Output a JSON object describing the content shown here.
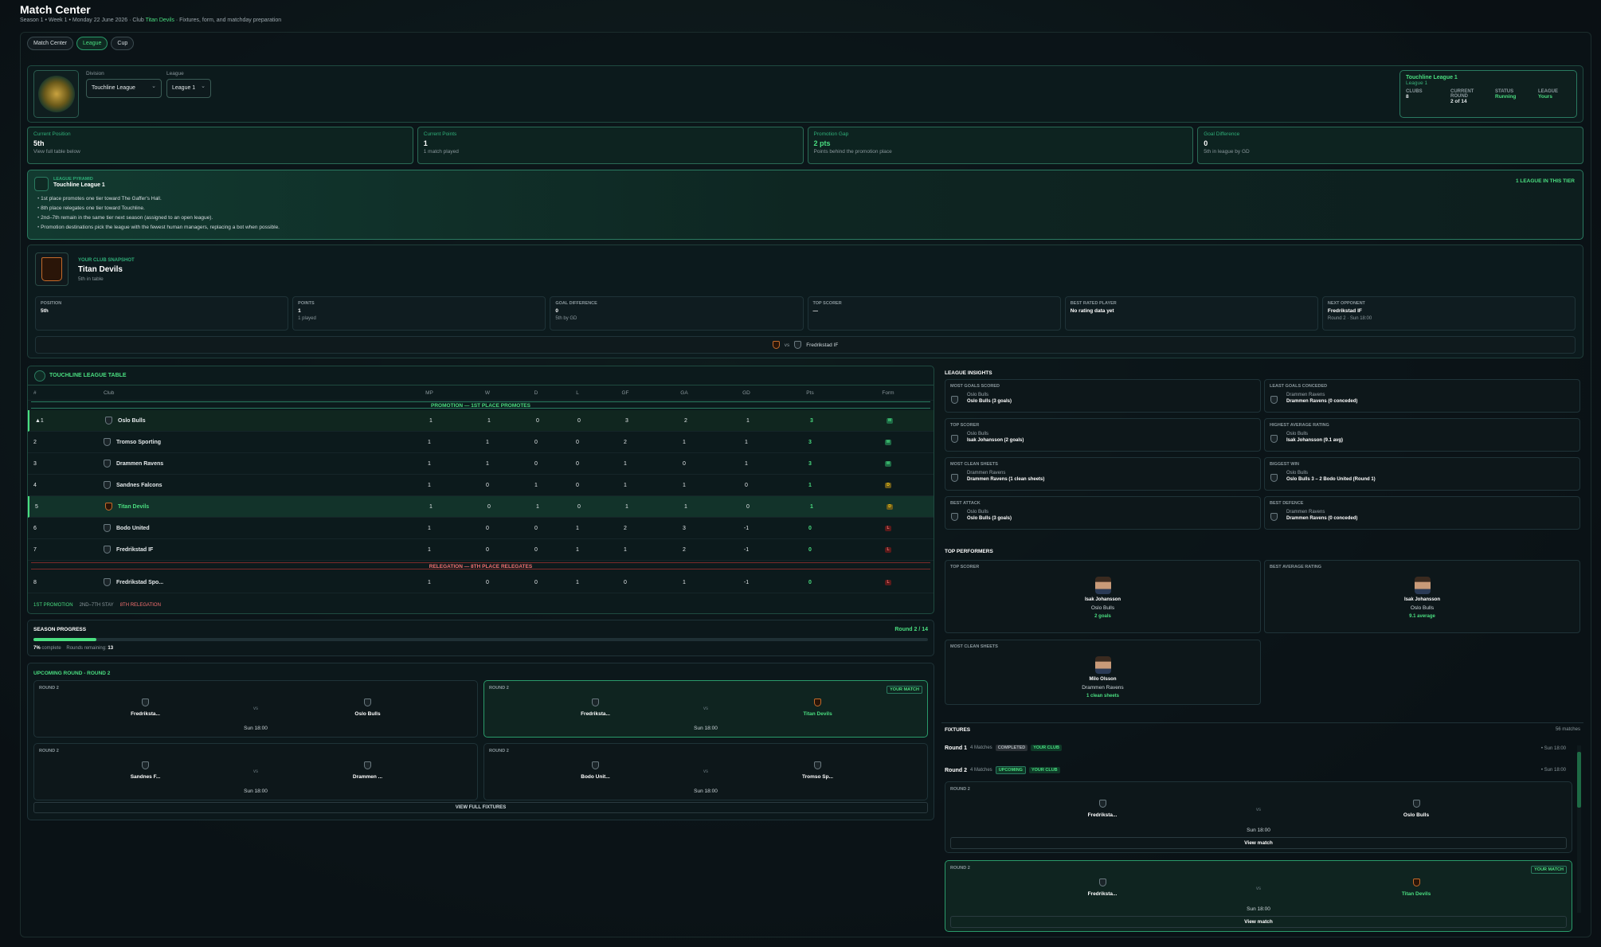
{
  "header": {
    "title": "Match Center",
    "subtitle": "Season 1 • Week 1 • Monday 22 June 2026 · Club",
    "club": "Titan Devils",
    "subtitle_rest": "· Fixtures, form, and matchday preparation"
  },
  "tabs": [
    {
      "label": "Match Center",
      "active": false
    },
    {
      "label": "League",
      "active": true
    },
    {
      "label": "Cup",
      "active": false
    }
  ],
  "selector": {
    "logo_text": "TOUCHLINE FC",
    "division_label": "Division",
    "division_value": "Touchline League",
    "league_label": "League",
    "league_value": "League 1"
  },
  "league_info": {
    "title": "Touchline League 1",
    "subtitle": "League 1",
    "clubs_label": "CLUBS",
    "clubs": "8",
    "round_label": "CURRENT ROUND",
    "round": "2 of 14",
    "status_label": "STATUS",
    "status": "Running",
    "league_label": "LEAGUE",
    "league": "Yours"
  },
  "stats": [
    {
      "label": "Current Position",
      "value": "5th",
      "hint": "View full table below"
    },
    {
      "label": "Current Points",
      "value": "1",
      "hint": "1 match played"
    },
    {
      "label": "Promotion Gap",
      "value": "2 pts",
      "hint": "Points behind the promotion place"
    },
    {
      "label": "Goal Difference",
      "value": "0",
      "hint": "5th in league by GD"
    }
  ],
  "pyramid": {
    "tag": "LEAGUE PYRAMID",
    "name": "Touchline League 1",
    "badge": "1 LEAGUE IN THIS TIER",
    "rules": [
      "1st place promotes one tier toward The Gaffer's Hall.",
      "8th place relegates one tier toward Touchline.",
      "2nd–7th remain in the same tier next season (assigned to an open league).",
      "Promotion destinations pick the league with the fewest human managers, replacing a bot when possible."
    ]
  },
  "snapshot": {
    "tag": "YOUR CLUB SNAPSHOT",
    "name": "Titan Devils",
    "sub": "5th in table",
    "cards": [
      {
        "label": "POSITION",
        "value": "5th",
        "hint": ""
      },
      {
        "label": "POINTS",
        "value": "1",
        "hint": "1 played"
      },
      {
        "label": "GOAL DIFFERENCE",
        "value": "0",
        "hint": "5th by GD"
      },
      {
        "label": "TOP SCORER",
        "value": "—",
        "hint": ""
      },
      {
        "label": "BEST RATED PLAYER",
        "value": "No rating data yet",
        "hint": ""
      },
      {
        "label": "NEXT OPPONENT",
        "value": "Fredrikstad IF",
        "hint": "Round 2 · Sun 18:00"
      }
    ],
    "vs": "vs",
    "next": "Fredrikstad IF"
  },
  "table": {
    "title": "TOUCHLINE LEAGUE TABLE",
    "headers": [
      "#",
      "Club",
      "MP",
      "W",
      "D",
      "L",
      "GF",
      "GA",
      "GD",
      "Pts",
      "Form"
    ],
    "promotion_band": "PROMOTION — 1ST PLACE PROMOTES",
    "relegation_band": "RELEGATION — 8TH PLACE RELEGATES",
    "rows": [
      {
        "pos": "▲1",
        "club": "Oslo Bulls",
        "mp": "1",
        "w": "1",
        "d": "0",
        "l": "0",
        "gf": "3",
        "ga": "2",
        "gd": "1",
        "pts": "3",
        "form": "W"
      },
      {
        "pos": "2",
        "club": "Tromso Sporting",
        "mp": "1",
        "w": "1",
        "d": "0",
        "l": "0",
        "gf": "2",
        "ga": "1",
        "gd": "1",
        "pts": "3",
        "form": "W"
      },
      {
        "pos": "3",
        "club": "Drammen Ravens",
        "mp": "1",
        "w": "1",
        "d": "0",
        "l": "0",
        "gf": "1",
        "ga": "0",
        "gd": "1",
        "pts": "3",
        "form": "W"
      },
      {
        "pos": "4",
        "club": "Sandnes Falcons",
        "mp": "1",
        "w": "0",
        "d": "1",
        "l": "0",
        "gf": "1",
        "ga": "1",
        "gd": "0",
        "pts": "1",
        "form": "D"
      },
      {
        "pos": "5",
        "club": "Titan Devils",
        "mp": "1",
        "w": "0",
        "d": "1",
        "l": "0",
        "gf": "1",
        "ga": "1",
        "gd": "0",
        "pts": "1",
        "form": "D"
      },
      {
        "pos": "6",
        "club": "Bodo United",
        "mp": "1",
        "w": "0",
        "d": "0",
        "l": "1",
        "gf": "2",
        "ga": "3",
        "gd": "-1",
        "pts": "0",
        "form": "L"
      },
      {
        "pos": "7",
        "club": "Fredrikstad IF",
        "mp": "1",
        "w": "0",
        "d": "0",
        "l": "1",
        "gf": "1",
        "ga": "2",
        "gd": "-1",
        "pts": "0",
        "form": "L"
      },
      {
        "pos": "8",
        "club": "Fredrikstad Spo...",
        "mp": "1",
        "w": "0",
        "d": "0",
        "l": "1",
        "gf": "0",
        "ga": "1",
        "gd": "-1",
        "pts": "0",
        "form": "L"
      }
    ],
    "legend": [
      "1ST PROMOTION",
      "2ND–7TH STAY",
      "8TH RELEGATION"
    ]
  },
  "season": {
    "title": "SEASON PROGRESS",
    "round": "Round 2 / 14",
    "progress": 0.07,
    "pct": "7%",
    "pct_label": "complete",
    "remaining_label": "Rounds remaining:",
    "remaining": "13"
  },
  "upcoming": {
    "title": "UPCOMING ROUND - ROUND 2",
    "your_match": "YOUR MATCH",
    "view_all": "VIEW FULL FIXTURES",
    "matches": [
      {
        "round": "ROUND 2",
        "home": "Fredriksta...",
        "away": "Oslo Bulls",
        "time": "Sun 18:00",
        "mine": false
      },
      {
        "round": "ROUND 2",
        "home": "Fredriksta...",
        "away": "Titan Devils",
        "time": "Sun 18:00",
        "mine": true
      },
      {
        "round": "ROUND 2",
        "home": "Sandnes F...",
        "away": "Drammen ...",
        "time": "Sun 18:00",
        "mine": false
      },
      {
        "round": "ROUND 2",
        "home": "Bodo Unit...",
        "away": "Tromso Sp...",
        "time": "Sun 18:00",
        "mine": false
      }
    ],
    "vs": "vs"
  },
  "insights": {
    "title": "LEAGUE INSIGHTS",
    "cards": [
      {
        "label": "MOST GOALS SCORED",
        "club": "Oslo Bulls",
        "value": "Oslo Bulls (3 goals)"
      },
      {
        "label": "LEAST GOALS CONCEDED",
        "club": "Drammen Ravens",
        "value": "Drammen Ravens (0 conceded)"
      },
      {
        "label": "TOP SCORER",
        "club": "Oslo Bulls",
        "value": "Isak Johansson (2 goals)"
      },
      {
        "label": "HIGHEST AVERAGE RATING",
        "club": "Oslo Bulls",
        "value": "Isak Johansson (9.1 avg)"
      },
      {
        "label": "MOST CLEAN SHEETS",
        "club": "Drammen Ravens",
        "value": "Drammen Ravens (1 clean sheets)"
      },
      {
        "label": "BIGGEST WIN",
        "club": "Oslo Bulls",
        "value": "Oslo Bulls 3 – 2 Bodo United (Round 1)"
      },
      {
        "label": "BEST ATTACK",
        "club": "Oslo Bulls",
        "value": "Oslo Bulls (3 goals)"
      },
      {
        "label": "BEST DEFENCE",
        "club": "Drammen Ravens",
        "value": "Drammen Ravens (0 conceded)"
      }
    ]
  },
  "performers": {
    "title": "TOP PERFORMERS",
    "cards": [
      {
        "label": "TOP SCORER",
        "name": "Isak Johansson",
        "club": "Oslo Bulls",
        "value": "2 goals"
      },
      {
        "label": "BEST AVERAGE RATING",
        "name": "Isak Johansson",
        "club": "Oslo Bulls",
        "value": "9.1 average"
      },
      {
        "label": "MOST CLEAN SHEETS",
        "name": "Milo Olsson",
        "club": "Drammen Ravens",
        "value": "1 clean sheets"
      }
    ]
  },
  "fixtures": {
    "title": "FIXTURES",
    "count": "56 matches",
    "rounds": [
      {
        "name": "Round 1",
        "matches": "4 Matches",
        "status": "COMPLETED",
        "tag": "YOUR CLUB",
        "date": "• Sun 18:00"
      },
      {
        "name": "Round 2",
        "matches": "4 Matches",
        "status": "UPCOMING",
        "tag": "YOUR CLUB",
        "date": "• Sun 18:00"
      }
    ],
    "cards": [
      {
        "round": "ROUND 2",
        "home": "Fredriksta...",
        "away": "Oslo Bulls",
        "time": "Sun 18:00",
        "mine": false
      },
      {
        "round": "ROUND 2",
        "home": "Fredriksta...",
        "away": "Titan Devils",
        "time": "Sun 18:00",
        "mine": true
      }
    ],
    "view_match": "View match"
  },
  "colors": {
    "accent": "#4ade80",
    "background": "#0c1419",
    "danger": "#f87171",
    "draw": "#facc15"
  }
}
